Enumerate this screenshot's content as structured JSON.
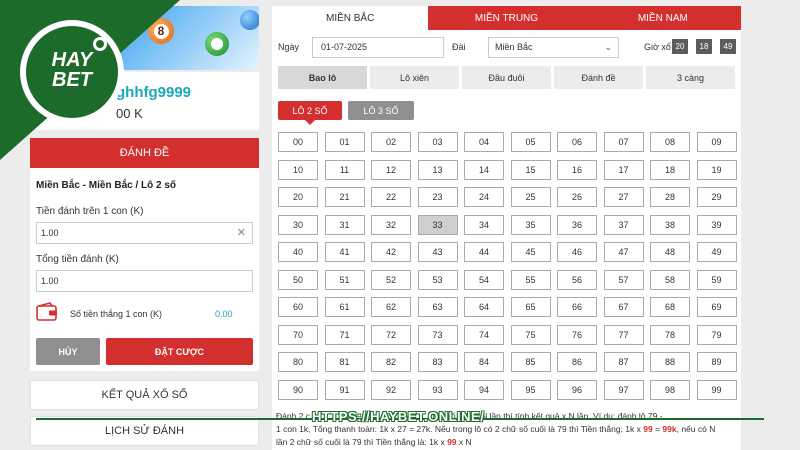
{
  "user": {
    "username": "ghhfg9999",
    "balance": "00 K"
  },
  "bet_panel": {
    "header_button": "ĐÁNH ĐỀ",
    "title": "Miền Bắc - Miền Bắc / Lô 2 số",
    "stake_label": "Tiền đánh trên 1 con (K)",
    "stake_value": "1.00",
    "total_label": "Tổng tiền đánh (K)",
    "total_value": "1.00",
    "win_label": "Số tiền thắng 1 con (K)",
    "win_value": "0.00",
    "cancel_label": "HỦY",
    "place_label": "ĐẶT CƯỢC"
  },
  "side_links": {
    "results": "KẾT QUẢ XỔ SỐ",
    "history": "LỊCH SỬ ĐÁNH"
  },
  "region_tabs": [
    {
      "label": "MIỀN BẮC",
      "active": true
    },
    {
      "label": "MIỀN TRUNG",
      "active": false
    },
    {
      "label": "MIỀN NAM",
      "active": false
    }
  ],
  "filters": {
    "date_label": "Ngày",
    "date_value": "01-07-2025",
    "station_label": "Đài",
    "station_value": "Miền Bắc",
    "clock_label": "Giờ xổ",
    "clock": [
      "20",
      "18",
      "49"
    ]
  },
  "bet_types": [
    {
      "label": "Bao lô",
      "active": true
    },
    {
      "label": "Lô xiên",
      "active": false
    },
    {
      "label": "Đầu đuôi",
      "active": false
    },
    {
      "label": "Đánh đề",
      "active": false
    },
    {
      "label": "3 càng",
      "active": false
    }
  ],
  "sub_types": {
    "lo2": "LÔ 2 SỐ",
    "lo3": "LÔ 3 SỐ"
  },
  "numbers": {
    "selected": [
      "33"
    ],
    "values": [
      "00",
      "01",
      "02",
      "03",
      "04",
      "05",
      "06",
      "07",
      "08",
      "09",
      "10",
      "11",
      "12",
      "13",
      "14",
      "15",
      "16",
      "17",
      "18",
      "19",
      "20",
      "21",
      "22",
      "23",
      "24",
      "25",
      "26",
      "27",
      "28",
      "29",
      "30",
      "31",
      "32",
      "33",
      "34",
      "35",
      "36",
      "37",
      "38",
      "39",
      "40",
      "41",
      "42",
      "43",
      "44",
      "45",
      "46",
      "47",
      "48",
      "49",
      "50",
      "51",
      "52",
      "53",
      "54",
      "55",
      "56",
      "57",
      "58",
      "59",
      "60",
      "61",
      "62",
      "63",
      "64",
      "65",
      "66",
      "67",
      "68",
      "69",
      "70",
      "71",
      "72",
      "73",
      "74",
      "75",
      "76",
      "77",
      "78",
      "79",
      "80",
      "81",
      "82",
      "83",
      "84",
      "85",
      "86",
      "87",
      "88",
      "89",
      "90",
      "91",
      "92",
      "93",
      "94",
      "95",
      "96",
      "97",
      "98",
      "99"
    ]
  },
  "note": {
    "line1_a": "Đánh 2 c",
    "line1_b": "nếu số đó về N lần thì tính kết quả x N lần. Ví dụ: đánh lô 79 -",
    "line2_a": "1 con 1k, Tổng thanh toán: 1k x 27 = 27k. Nếu trong lô có 2 chữ số cuối là 79 thì Tiền thắng: 1k x ",
    "line2_red1": "99",
    "line2_b": " = ",
    "line2_red2": "99k",
    "line2_c": ", nếu có N",
    "line3_a": "lần 2 chữ số cuối là 79 thì Tiền thắng là: 1k x ",
    "line3_red": "99",
    "line3_b": " x N"
  },
  "branding": {
    "logo_top": "HAY",
    "logo_bottom": "BET",
    "watermark": "HTTPS://HAYBET.ONLINE/"
  },
  "colors": {
    "primary_red": "#d32f2f",
    "teal": "#19a8b8",
    "logo_green": "#1c6b2a"
  }
}
